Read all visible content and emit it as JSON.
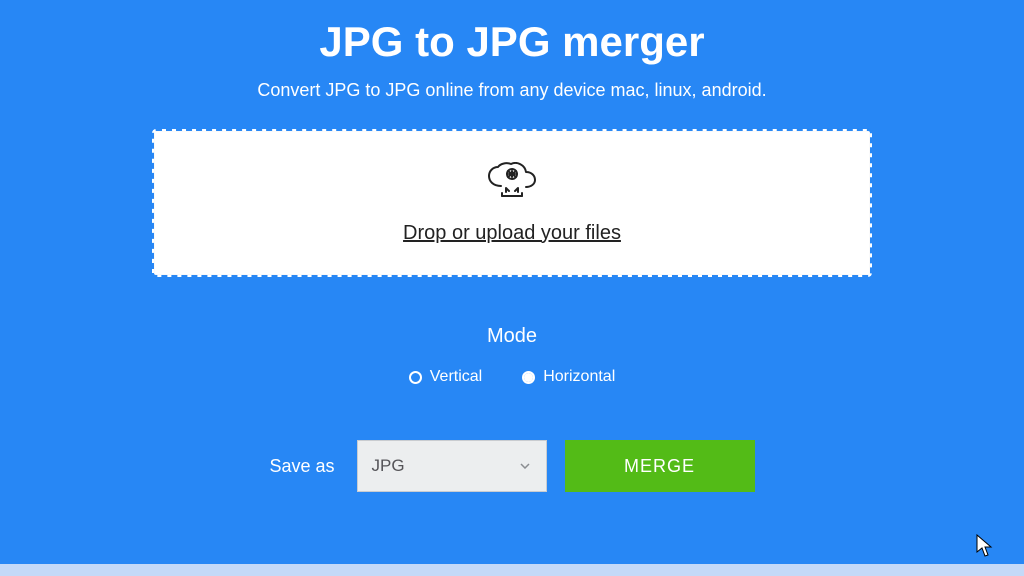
{
  "header": {
    "title": "JPG to JPG merger",
    "subtitle": "Convert JPG to JPG online from any device mac, linux, android."
  },
  "dropzone": {
    "label": "Drop or upload your files"
  },
  "mode": {
    "title": "Mode",
    "options": {
      "vertical": "Vertical",
      "horizontal": "Horizontal"
    },
    "selected": "horizontal"
  },
  "saveas": {
    "label": "Save as",
    "value": "JPG"
  },
  "merge": {
    "label": "MERGE"
  }
}
